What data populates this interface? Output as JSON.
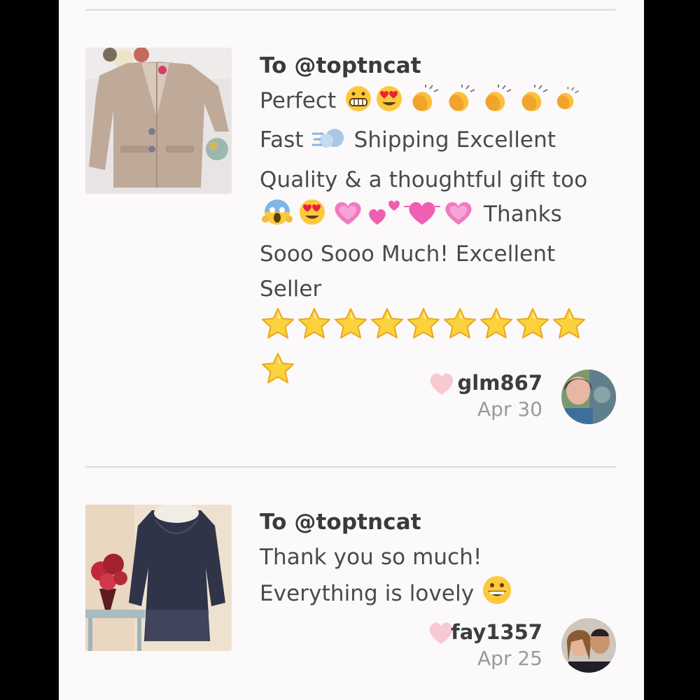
{
  "reviews": [
    {
      "to_line": "To @toptncat",
      "lines": [
        {
          "text_before": "Perfect ",
          "emojis_after": [
            "grimace-emoji",
            "heart-eyes-emoji",
            "clap-emoji",
            "clap-emoji",
            "clap-emoji",
            "clap-emoji",
            "clap-emoji"
          ]
        },
        {
          "text_before": "Fast ",
          "emojis_after": [
            "dash-emoji"
          ],
          "text_after": " Shipping Excellent"
        },
        {
          "text_before": "Quality & a thoughtful gift too"
        },
        {
          "emojis_before": [
            "scream-emoji",
            "heart-eyes-emoji",
            "growing-heart-emoji",
            "two-hearts-emoji",
            "heartbeat-emoji",
            "growing-heart-emoji"
          ],
          "text_after": " Thanks"
        },
        {
          "text_before": "Sooo Sooo Much! Excellent"
        },
        {
          "text_before": "Seller"
        }
      ],
      "star_count": 10,
      "username": "glm867",
      "date": "Apr 30",
      "liked": false
    },
    {
      "to_line": "To @toptncat",
      "line1": "Thank you so much!",
      "line2": "Everything is lovely",
      "username": "fay1357",
      "date": "Apr 25",
      "liked": false
    }
  ],
  "icons": {
    "heart": "heart-icon",
    "star": "star-emoji"
  },
  "colors": {
    "heart_pink": "#f9c9d3",
    "text": "#4a4a4a",
    "date": "#9a9a9a",
    "panel": "#fbf9fa"
  }
}
